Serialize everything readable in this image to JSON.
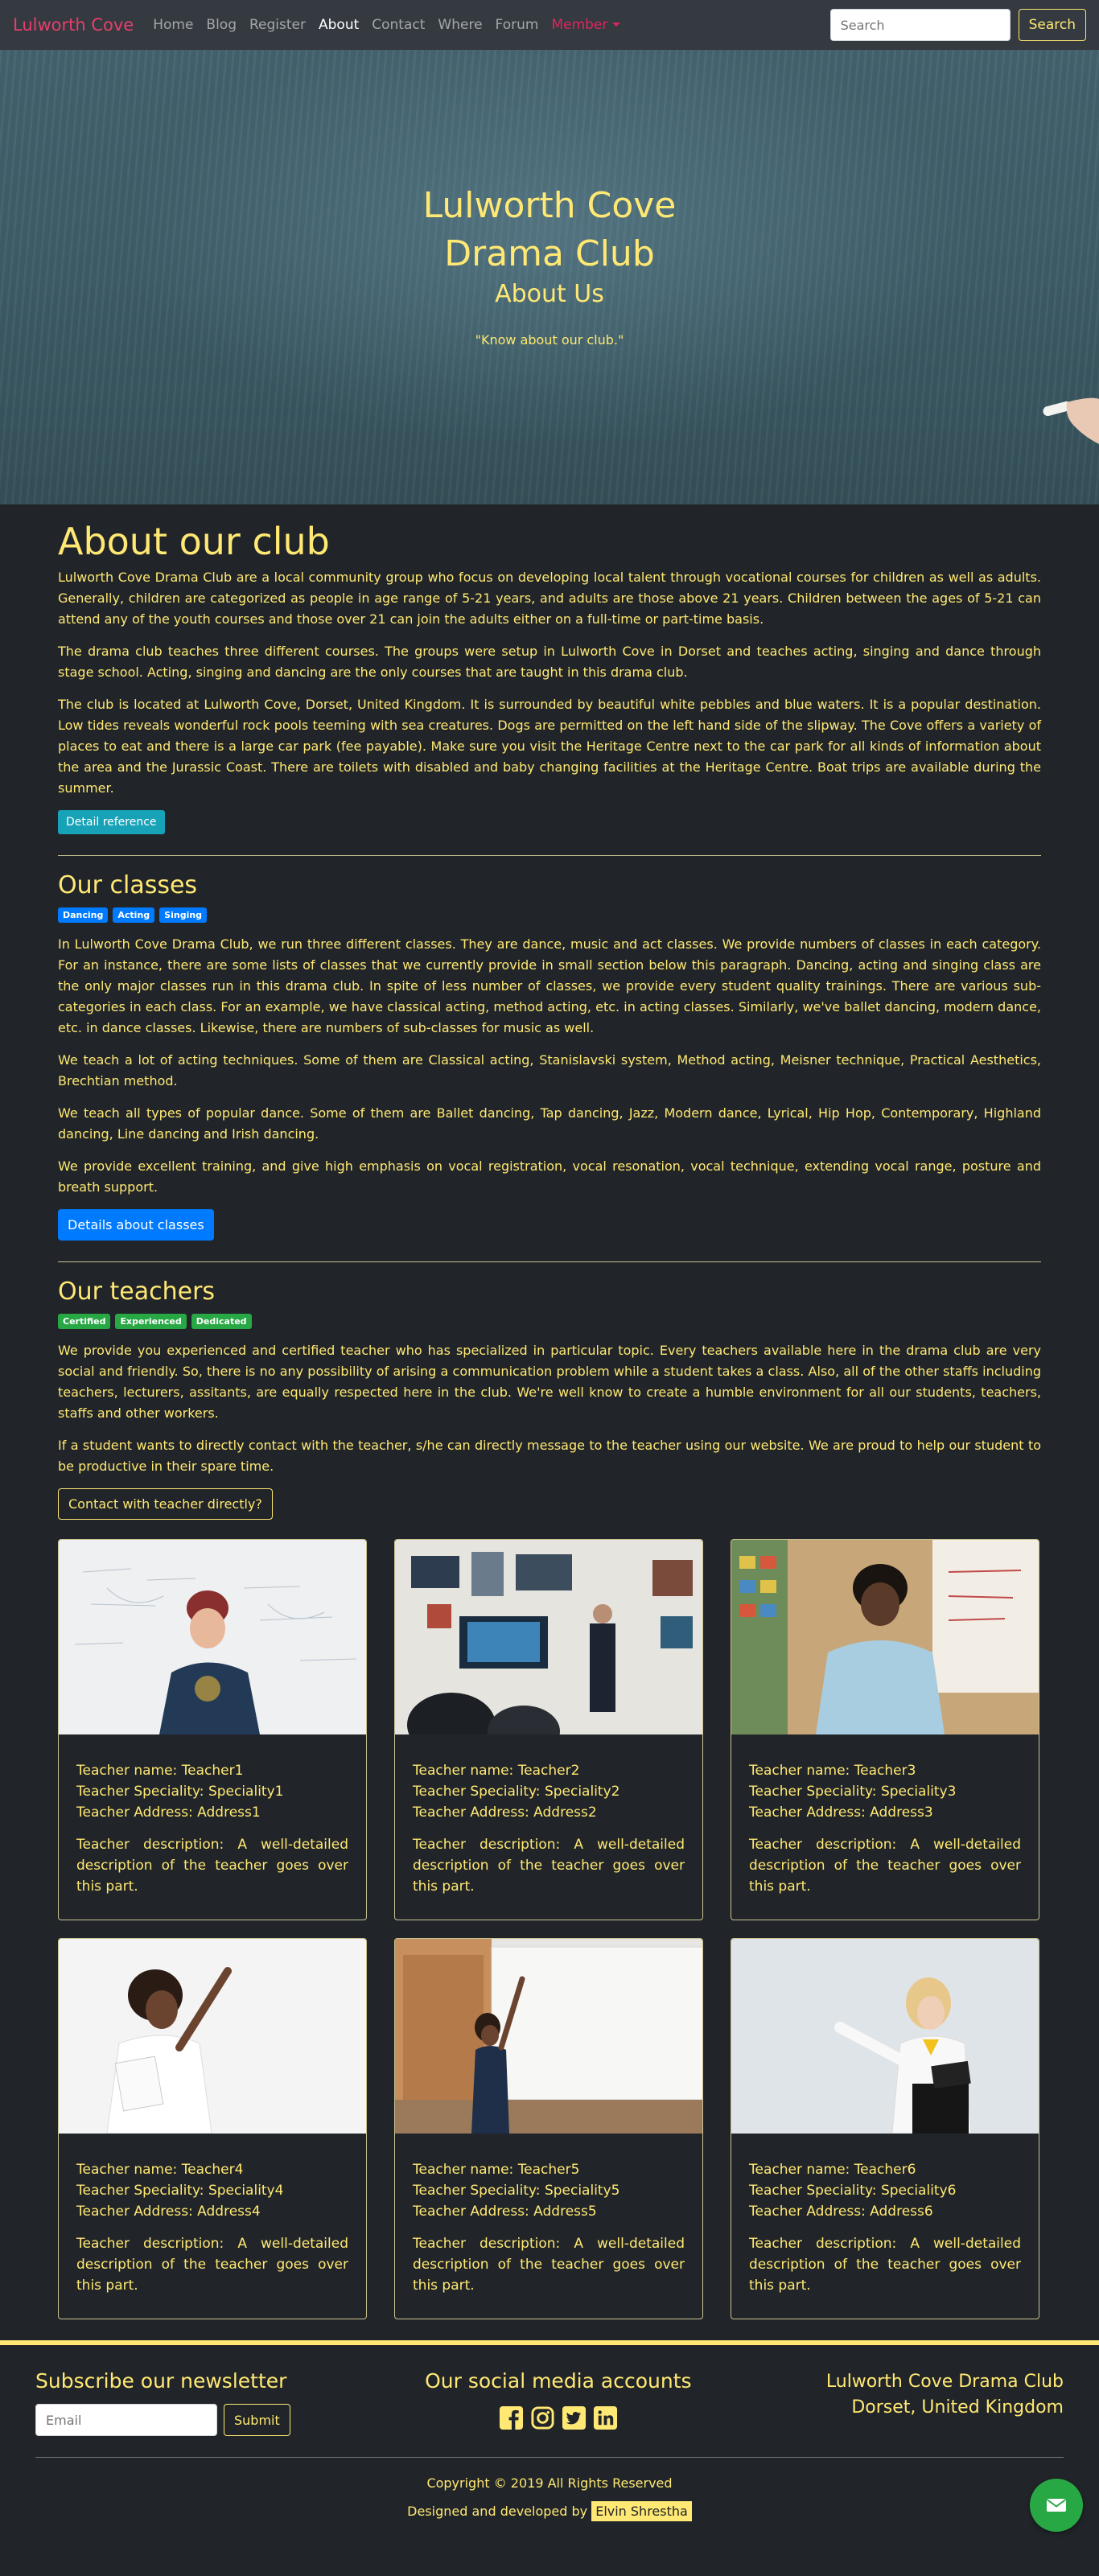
{
  "nav": {
    "brand": "Lulworth Cove",
    "links": [
      "Home",
      "Blog",
      "Register",
      "About",
      "Contact",
      "Where",
      "Forum"
    ],
    "member": "Member",
    "search_placeholder": "Search",
    "search_button": "Search"
  },
  "hero": {
    "title_line1": "Lulworth Cove",
    "title_line2": "Drama Club",
    "subtitle": "About Us",
    "quote": "\"Know about our club.\""
  },
  "about": {
    "heading": "About our club",
    "paragraphs": [
      "Lulworth Cove Drama Club are a local community group who focus on developing local talent through vocational courses for children as well as adults. Generally, children are categorized as people in age range of 5-21 years, and adults are those above 21 years. Children between the ages of 5-21 can attend any of the youth courses and those over 21 can join the adults either on a full-time or part-time basis.",
      "The drama club teaches three different courses. The groups were setup in Lulworth Cove in Dorset and teaches acting, singing and dance through stage school. Acting, singing and dancing are the only courses that are taught in this drama club.",
      "The club is located at Lulworth Cove, Dorset, United Kingdom. It is surrounded by beautiful white pebbles and blue waters. It is a popular destination. Low tides reveals wonderful rock pools teeming with sea creatures. Dogs are permitted on the left hand side of the slipway. The Cove offers a variety of places to eat and there is a large car park (fee payable). Make sure you visit the Heritage Centre next to the car park for all kinds of information about the area and the Jurassic Coast. There are toilets with disabled and baby changing facilities at the Heritage Centre. Boat trips are available during the summer."
    ],
    "button": "Detail reference"
  },
  "classes": {
    "heading": "Our classes",
    "badges": [
      "Dancing",
      "Acting",
      "Singing"
    ],
    "paragraphs": [
      "In Lulworth Cove Drama Club, we run three different classes. They are dance, music and act classes. We provide numbers of classes in each category. For an instance, there are some lists of classes that we currently provide in small section below this paragraph. Dancing, acting and singing class are the only major classes run in this drama club. In spite of less number of classes, we provide every student quality trainings. There are various sub-categories in each class. For an example, we have classical acting, method acting, etc. in acting classes. Similarly, we've ballet dancing, modern dance, etc. in dance classes. Likewise, there are numbers of sub-classes for music as well.",
      "We teach a lot of acting techniques. Some of them are Classical acting, Stanislavski system, Method acting, Meisner technique, Practical Aesthetics, Brechtian method.",
      "We teach all types of popular dance. Some of them are Ballet dancing, Tap dancing, Jazz, Modern dance, Lyrical, Hip Hop, Contemporary, Highland dancing, Line dancing and Irish dancing.",
      "We provide excellent training, and give high emphasis on vocal registration, vocal resonation, vocal technique, extending vocal range, posture and breath support."
    ],
    "button": "Details about classes"
  },
  "teachers": {
    "heading": "Our teachers",
    "badges": [
      "Certified",
      "Experienced",
      "Dedicated"
    ],
    "paragraphs": [
      "We provide you experienced and certified teacher who has specialized in particular topic. Every teachers available here in the drama club are very social and friendly. So, there is no any possibility of arising a communication problem while a student takes a class. Also, all of the other staffs including teachers, lecturers, assitants, are equally respected here in the club. We're well know to create a humble environment for all our students, teachers, staffs and other workers.",
      "If a student wants to directly contact with the teacher, s/he can directly message to the teacher using our website. We are proud to help our student to be productive in their spare time."
    ],
    "button": "Contact with teacher directly?",
    "cards": [
      {
        "name": "Teacher name: Teacher1",
        "speciality": "Teacher Speciality: Speciality1",
        "address": "Teacher Address: Address1",
        "description": "Teacher description: A well-detailed description of the teacher goes over this part."
      },
      {
        "name": "Teacher name: Teacher2",
        "speciality": "Teacher Speciality: Speciality2",
        "address": "Teacher Address: Address2",
        "description": "Teacher description: A well-detailed description of the teacher goes over this part."
      },
      {
        "name": "Teacher name: Teacher3",
        "speciality": "Teacher Speciality: Speciality3",
        "address": "Teacher Address: Address3",
        "description": "Teacher description: A well-detailed description of the teacher goes over this part."
      },
      {
        "name": "Teacher name: Teacher4",
        "speciality": "Teacher Speciality: Speciality4",
        "address": "Teacher Address: Address4",
        "description": "Teacher description: A well-detailed description of the teacher goes over this part."
      },
      {
        "name": "Teacher name: Teacher5",
        "speciality": "Teacher Speciality: Speciality5",
        "address": "Teacher Address: Address5",
        "description": "Teacher description: A well-detailed description of the teacher goes over this part."
      },
      {
        "name": "Teacher name: Teacher6",
        "speciality": "Teacher Speciality: Speciality6",
        "address": "Teacher Address: Address6",
        "description": "Teacher description: A well-detailed description of the teacher goes over this part."
      }
    ]
  },
  "footer": {
    "newsletter_heading": "Subscribe our newsletter",
    "email_placeholder": "Email",
    "submit_button": "Submit",
    "social_heading": "Our social media accounts",
    "social_icons": [
      "facebook-icon",
      "instagram-icon",
      "twitter-icon",
      "linkedin-icon"
    ],
    "address_line1": "Lulworth Cove Drama Club",
    "address_line2": "Dorset, United Kingdom",
    "copyright": "Copyright © 2019 All Rights Reserved",
    "credit_prefix": "Designed and developed by",
    "credit_name": "Elvin Shrestha"
  },
  "colors": {
    "text_accent": "#ffe873",
    "background": "#212529",
    "brand": "#e83e6c",
    "info_button": "#17a2b8",
    "primary_button": "#007bff",
    "badge_green": "#28a745",
    "chat_button": "#28a745"
  }
}
